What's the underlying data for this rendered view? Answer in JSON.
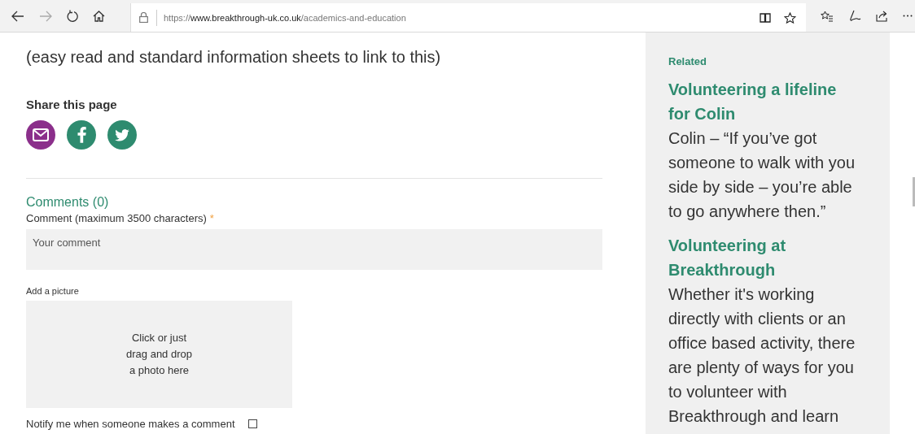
{
  "browser": {
    "forward_disabled": true,
    "url": {
      "scheme": "https://",
      "host": "www.breakthrough-uk.co.uk",
      "path": "/academics-and-education"
    }
  },
  "article": {
    "intro": "(easy read and standard information sheets to link to this)",
    "share": {
      "title": "Share this page",
      "buttons": [
        {
          "kind": "email",
          "color": "#8b2f8b"
        },
        {
          "kind": "facebook",
          "color": "#2e8b6f"
        },
        {
          "kind": "twitter",
          "color": "#2e8b6f"
        }
      ]
    },
    "comments": {
      "heading": "Comments (0)",
      "label": "Comment (maximum 3500 characters)",
      "required": "*",
      "placeholder": "Your comment",
      "picture_label": "Add a picture",
      "dropzone": [
        "Click or just",
        "drag and drop",
        "a photo here"
      ],
      "notify": {
        "label": "Notify me when someone makes a comment",
        "checked": false
      }
    }
  },
  "sidebar": {
    "title": "Related",
    "items": [
      {
        "title": "Volunteering a lifeline for Colin",
        "text": "Colin – “If you’ve got someone to walk with you side by side – you’re able to go anywhere then.”"
      },
      {
        "title": "Volunteering at Breakthrough",
        "text": "Whether it's working directly with clients or an office based activity, there are plenty of ways for you to volunteer with Breakthrough and learn"
      }
    ]
  }
}
